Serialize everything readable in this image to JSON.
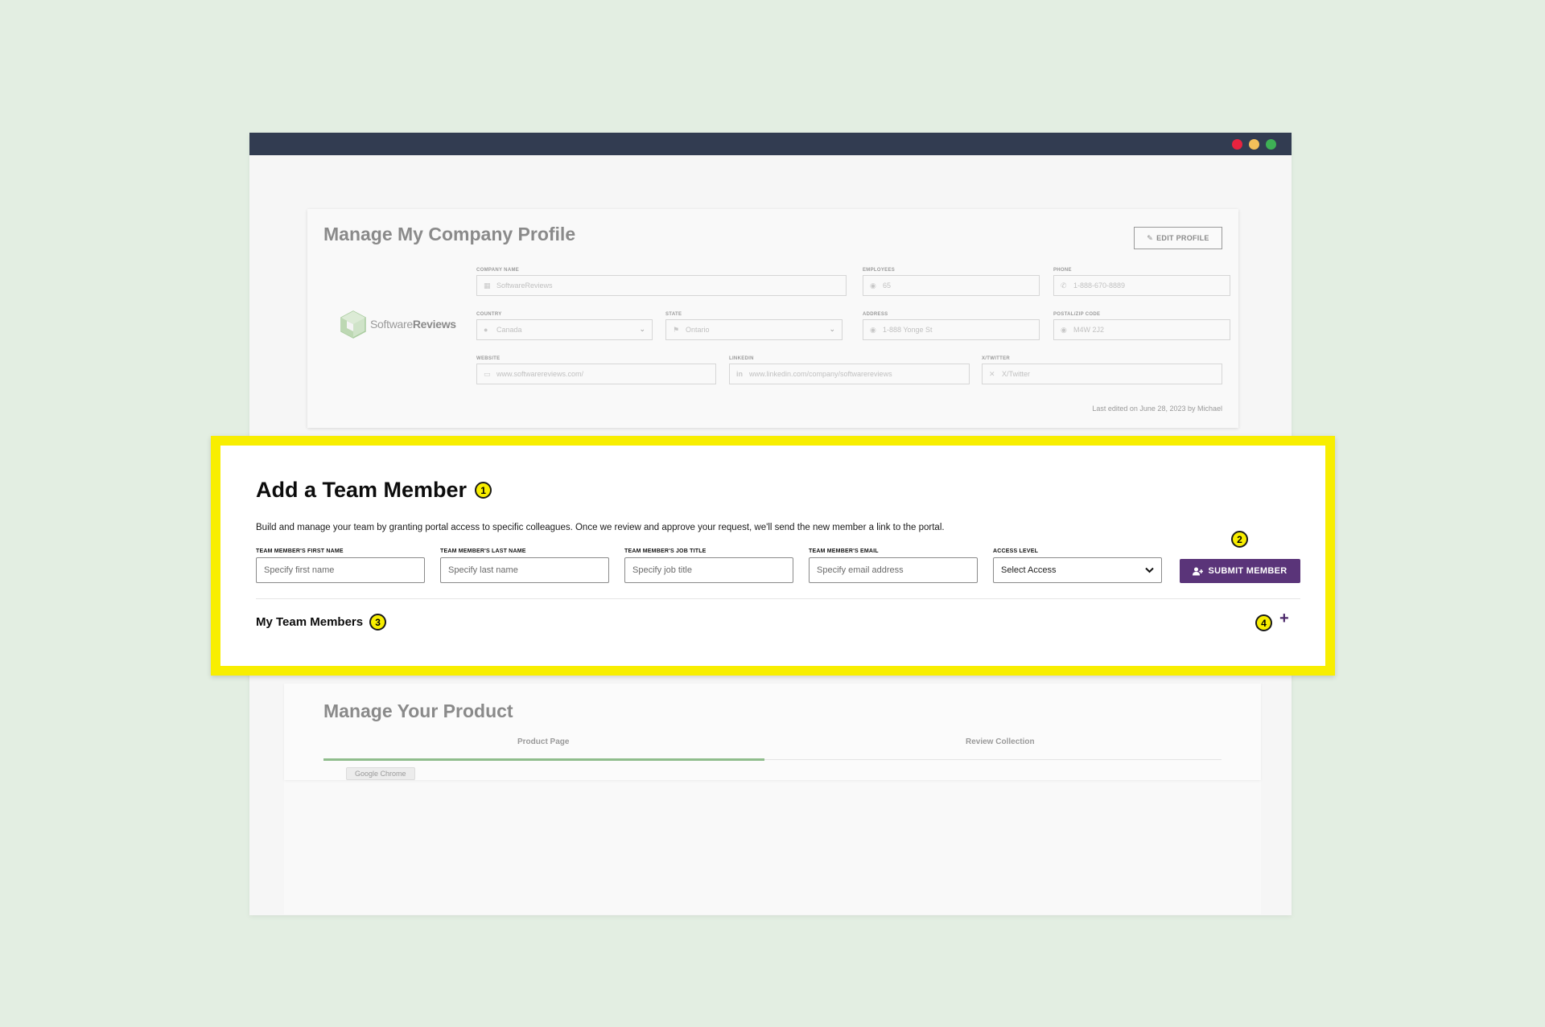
{
  "window": {
    "colors": {
      "titlebar": "#323c51",
      "close": "#e8233f",
      "minimize": "#f4c05a",
      "maximize": "#3eb055"
    }
  },
  "profile": {
    "title": "Manage My Company Profile",
    "edit_button": "EDIT PROFILE",
    "logo": {
      "text_light": "Software",
      "text_bold": "Reviews"
    },
    "fields": {
      "company_name": {
        "label": "COMPANY NAME",
        "value": "SoftwareReviews",
        "icon": "building-icon"
      },
      "employees": {
        "label": "EMPLOYEES",
        "value": "65",
        "icon": "people-icon"
      },
      "phone": {
        "label": "PHONE",
        "value": "1-888-670-8889",
        "icon": "phone-icon"
      },
      "country": {
        "label": "COUNTRY",
        "value": "Canada",
        "icon": "globe-icon"
      },
      "state": {
        "label": "STATE",
        "value": "Ontario",
        "icon": "flag-icon"
      },
      "address": {
        "label": "ADDRESS",
        "value": "1-888 Yonge St",
        "icon": "pin-icon"
      },
      "postal": {
        "label": "POSTAL/ZIP CODE",
        "value": "M4W 2J2",
        "icon": "pin-icon"
      },
      "website": {
        "label": "WEBSITE",
        "value": "www.softwarereviews.com/",
        "icon": "monitor-icon"
      },
      "linkedin": {
        "label": "LINKEDIN",
        "value": "www.linkedin.com/company/softwarereviews",
        "icon": "linkedin-icon"
      },
      "twitter": {
        "label": "X/TWITTER",
        "value": "X/Twitter",
        "icon": "x-icon"
      }
    },
    "last_edited": "Last edited on June 28, 2023 by Michael"
  },
  "team": {
    "title": "Add a Team Member",
    "description": "Build and manage your team by granting portal access to specific colleagues. Once we review and approve your request, we'll send the new member a link to the portal.",
    "fields": {
      "first_name": {
        "label": "TEAM MEMBER'S FIRST NAME",
        "placeholder": "Specify first name"
      },
      "last_name": {
        "label": "TEAM MEMBER'S LAST NAME",
        "placeholder": "Specify last name"
      },
      "job_title": {
        "label": "TEAM MEMBER'S JOB TITLE",
        "placeholder": "Specify job title"
      },
      "email": {
        "label": "TEAM MEMBER'S EMAIL",
        "placeholder": "Specify email address"
      },
      "access": {
        "label": "ACCESS LEVEL",
        "value": "Select Access"
      }
    },
    "submit_button": "SUBMIT MEMBER",
    "my_team_label": "My Team Members",
    "badges": {
      "b1": "1",
      "b2": "2",
      "b3": "3",
      "b4": "4"
    },
    "colors": {
      "highlight": "#f8ee00",
      "submit": "#5a3479",
      "plus": "#4d2a6b"
    }
  },
  "product": {
    "title": "Manage Your Product",
    "tabs": [
      {
        "label": "Product Page",
        "active": true
      },
      {
        "label": "Review Collection",
        "active": false
      }
    ],
    "chip": "Google Chrome",
    "colors": {
      "active_tab": "#8fbd8c"
    }
  }
}
